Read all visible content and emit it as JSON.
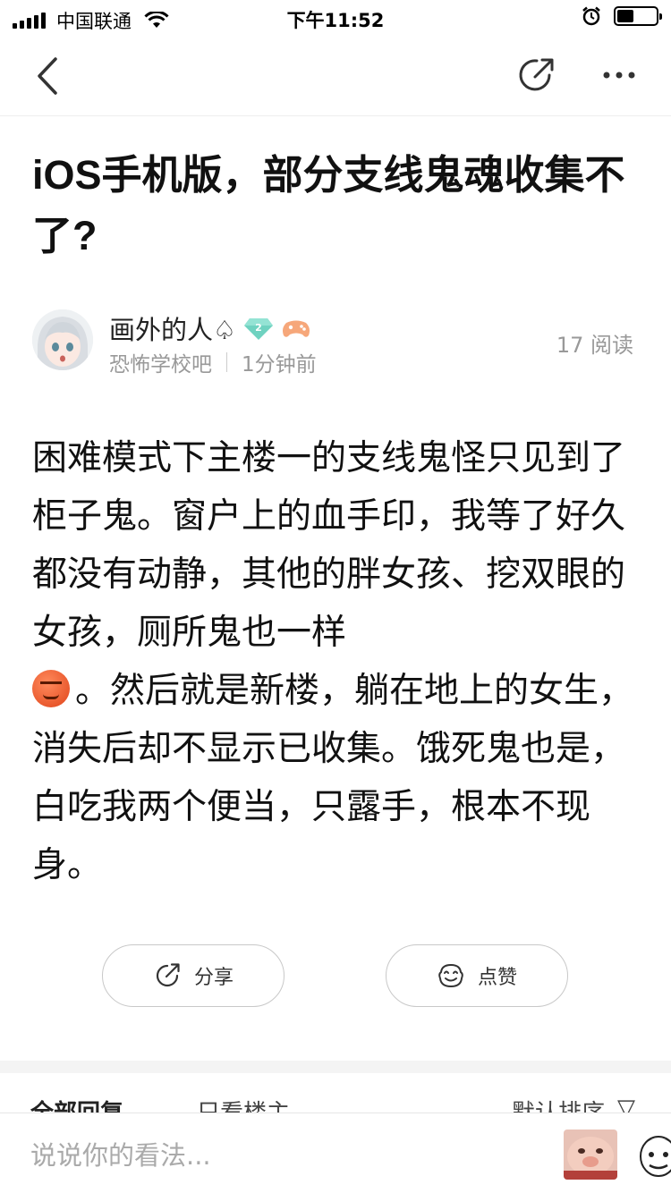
{
  "status_bar": {
    "carrier": "中国联通",
    "time": "下午11:52"
  },
  "post": {
    "title": "iOS手机版，部分支线鬼魂收集不了?",
    "author": "画外的人♤",
    "level": "2",
    "forum": "恐怖学校吧",
    "time_ago": "1分钟前",
    "reads": "17 阅读",
    "body_part1": "困难模式下主楼一的支线鬼怪只见到了柜子鬼。窗户上的血手印，我等了好久都没有动静，其他的胖女孩、挖双眼的女孩，厕所鬼也一样",
    "body_part2": "。然后就是新楼，躺在地上的女生，消失后却不显示已收集。饿死鬼也是，白吃我两个便当，只露手，根本不现身。"
  },
  "actions": {
    "share_label": "分享",
    "like_label": "点赞"
  },
  "tabs": {
    "all": "全部回复",
    "op_only": "只看楼主",
    "sort": "默认排序",
    "filter_icon": "▽"
  },
  "comment_bar": {
    "placeholder": "说说你的看法..."
  }
}
